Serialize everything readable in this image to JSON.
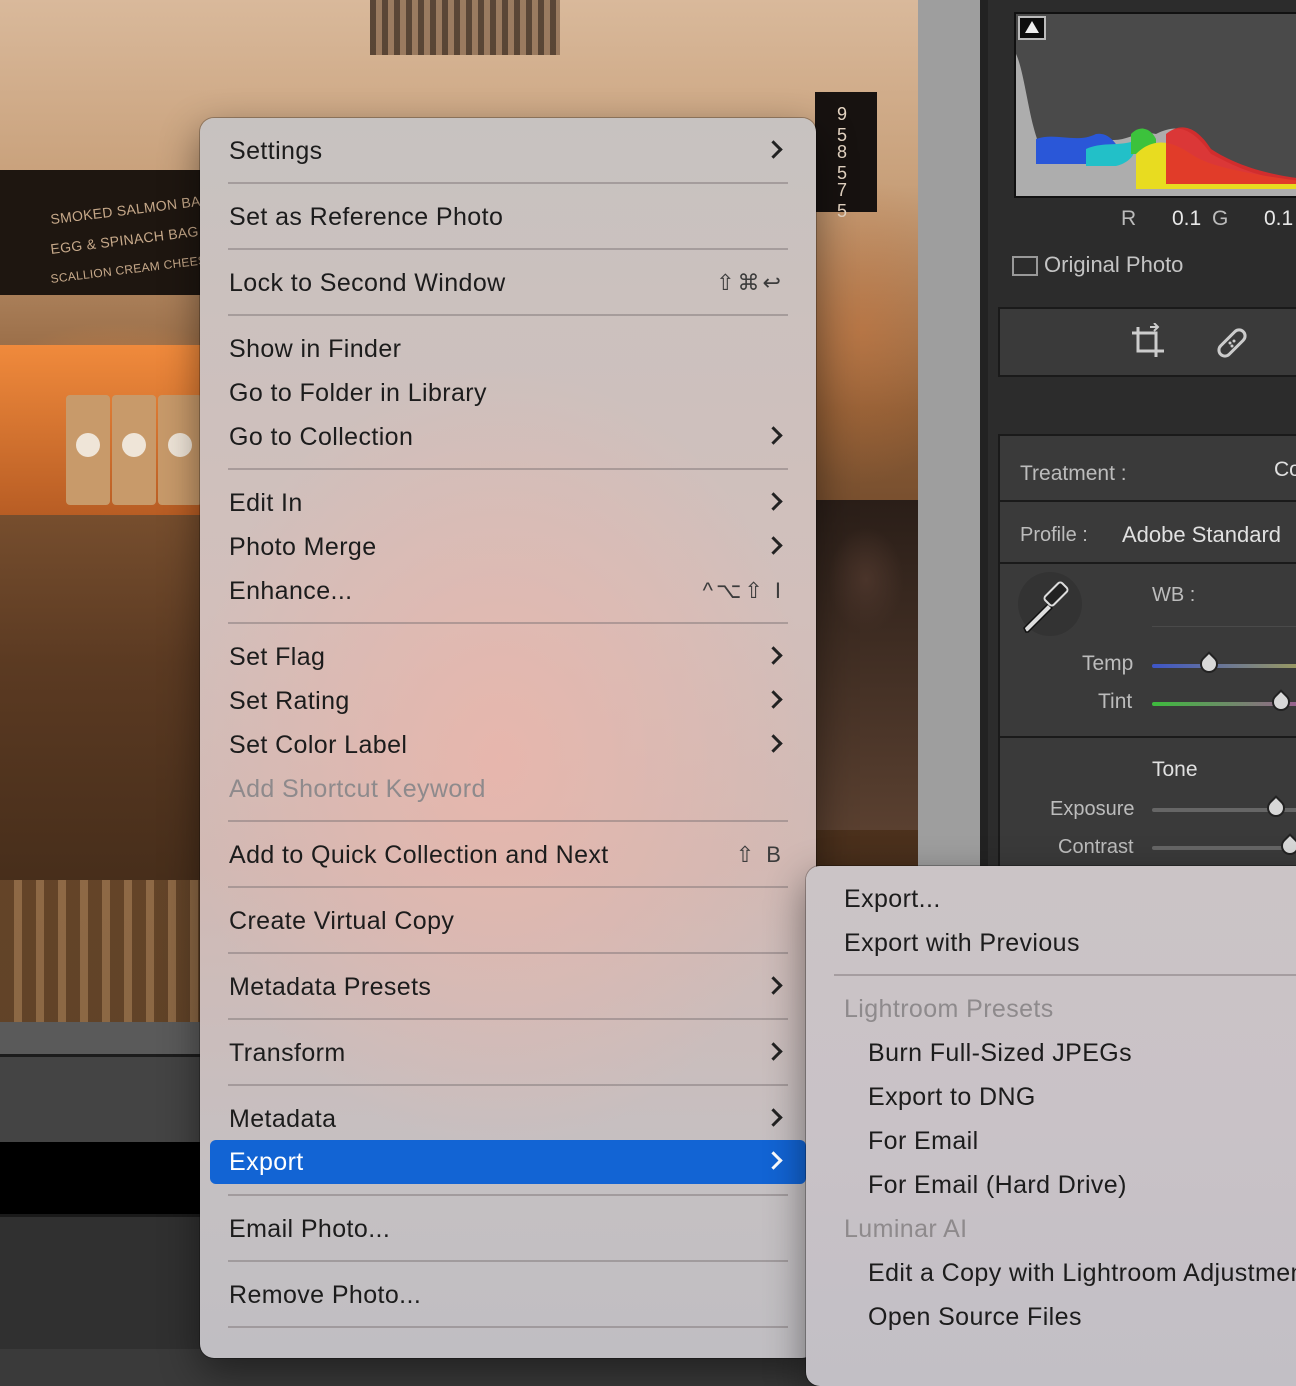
{
  "photo": {
    "board_lines": [
      "SMOKED SALMON BA",
      "EGG & SPINACH BAG",
      "SCALLION CREAM CHEESE"
    ],
    "price_lines": [
      "9 5",
      "8 5",
      "7 5"
    ]
  },
  "panel": {
    "histogram_readout": {
      "r_label": "R",
      "r_value": "0.1",
      "g_label": "G",
      "g_value": "0.1"
    },
    "original_photo_label": "Original Photo",
    "treatment_label": "Treatment :",
    "treatment_value": "Co",
    "profile_label": "Profile :",
    "profile_value": "Adobe Standard",
    "wb_label": "WB :",
    "temp_label": "Temp",
    "tint_label": "Tint",
    "tone_label": "Tone",
    "exposure_label": "Exposure",
    "contrast_label": "Contrast"
  },
  "context_menu": {
    "items": [
      {
        "label": "Settings",
        "submenu": true
      },
      {
        "label": "Set as Reference Photo"
      },
      {
        "label": "Lock to Second Window",
        "shortcut": "⇧⌘↩"
      },
      {
        "label": "Show in Finder"
      },
      {
        "label": "Go to Folder in Library"
      },
      {
        "label": "Go to Collection",
        "submenu": true
      },
      {
        "label": "Edit In",
        "submenu": true
      },
      {
        "label": "Photo Merge",
        "submenu": true
      },
      {
        "label": "Enhance...",
        "shortcut": "^⌥⇧ I"
      },
      {
        "label": "Set Flag",
        "submenu": true
      },
      {
        "label": "Set Rating",
        "submenu": true
      },
      {
        "label": "Set Color Label",
        "submenu": true
      },
      {
        "label": "Add Shortcut Keyword",
        "disabled": true
      },
      {
        "label": "Add to Quick Collection and Next",
        "shortcut": "⇧ B"
      },
      {
        "label": "Create Virtual Copy"
      },
      {
        "label": "Metadata Presets",
        "submenu": true
      },
      {
        "label": "Transform",
        "submenu": true
      },
      {
        "label": "Metadata",
        "submenu": true
      },
      {
        "label": "Export",
        "submenu": true,
        "selected": true
      },
      {
        "label": "Email Photo..."
      },
      {
        "label": "Remove Photo..."
      }
    ]
  },
  "export_submenu": {
    "items": [
      {
        "label": "Export..."
      },
      {
        "label": "Export with Previous"
      },
      {
        "label": "Lightroom Presets",
        "header": true
      },
      {
        "label": "Burn Full-Sized JPEGs"
      },
      {
        "label": "Export to DNG"
      },
      {
        "label": "For Email"
      },
      {
        "label": "For Email (Hard Drive)"
      },
      {
        "label": "Luminar AI",
        "header": true
      },
      {
        "label": "Edit a Copy with Lightroom Adjustments"
      },
      {
        "label": "Open Source Files"
      }
    ]
  },
  "colors": {
    "selection": "#1264d4",
    "menu_text": "#1c1c1c",
    "disabled_text": "#8e8a8c"
  }
}
